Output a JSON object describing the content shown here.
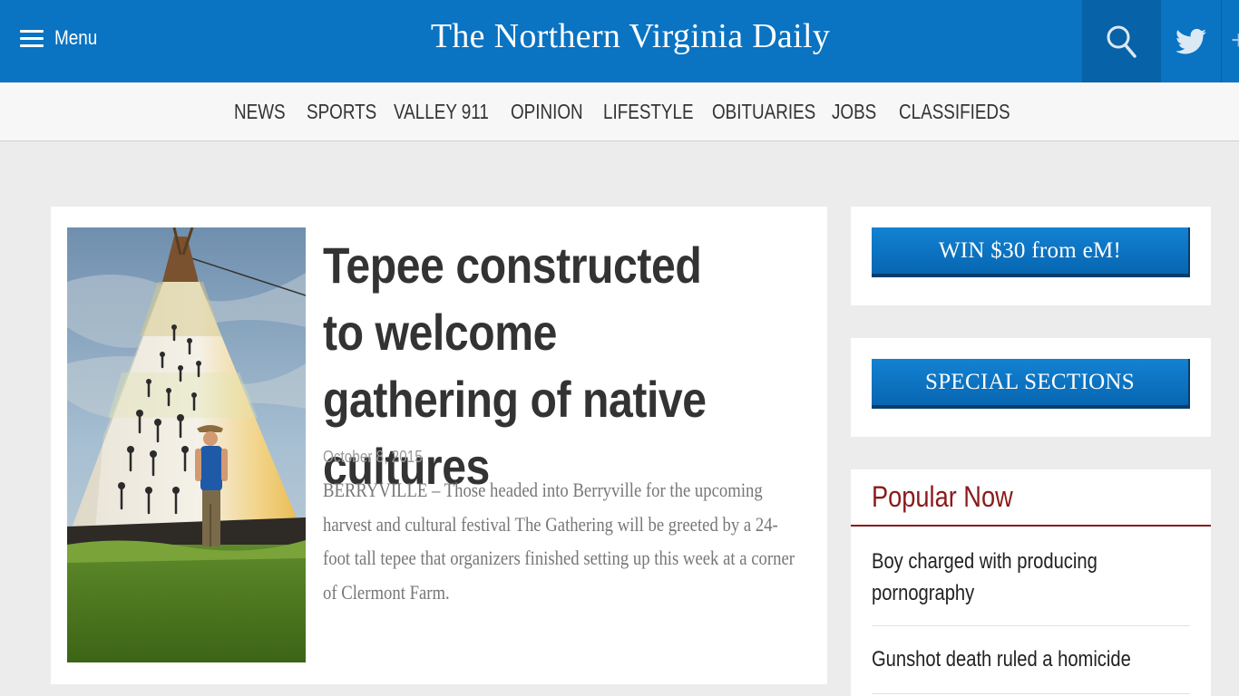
{
  "header": {
    "menu_label": "Menu",
    "site_title": "The Northern Virginia Daily",
    "icons": [
      "hamburger-icon",
      "search-icon",
      "twitter-icon"
    ],
    "brand_color": "#0a73c2"
  },
  "nav": {
    "items": [
      "NEWS",
      "SPORTS",
      "VALLEY 911",
      "OPINION",
      "LIFESTYLE",
      "OBITUARIES",
      "JOBS",
      "CLASSIFIEDS"
    ]
  },
  "article": {
    "headline": "Tepee constructed to welcome gathering of native cultures",
    "date": "October 8, 2015",
    "summary": "BERRYVILLE – Those headed into Berryville for the upcoming harvest and cultural festival The Gathering will be greeted by a 24-foot tall tepee that organizers finished setting up this week at a corner of Clermont Farm."
  },
  "sidebar": {
    "promo_label": "WIN $30 from eM!",
    "special_sections_label": "SPECIAL SECTIONS",
    "popular": {
      "title": "Popular Now",
      "items": [
        "Boy charged with producing pornography",
        "Gunshot death ruled a homicide"
      ],
      "accent_color": "#8b1a1a"
    }
  }
}
